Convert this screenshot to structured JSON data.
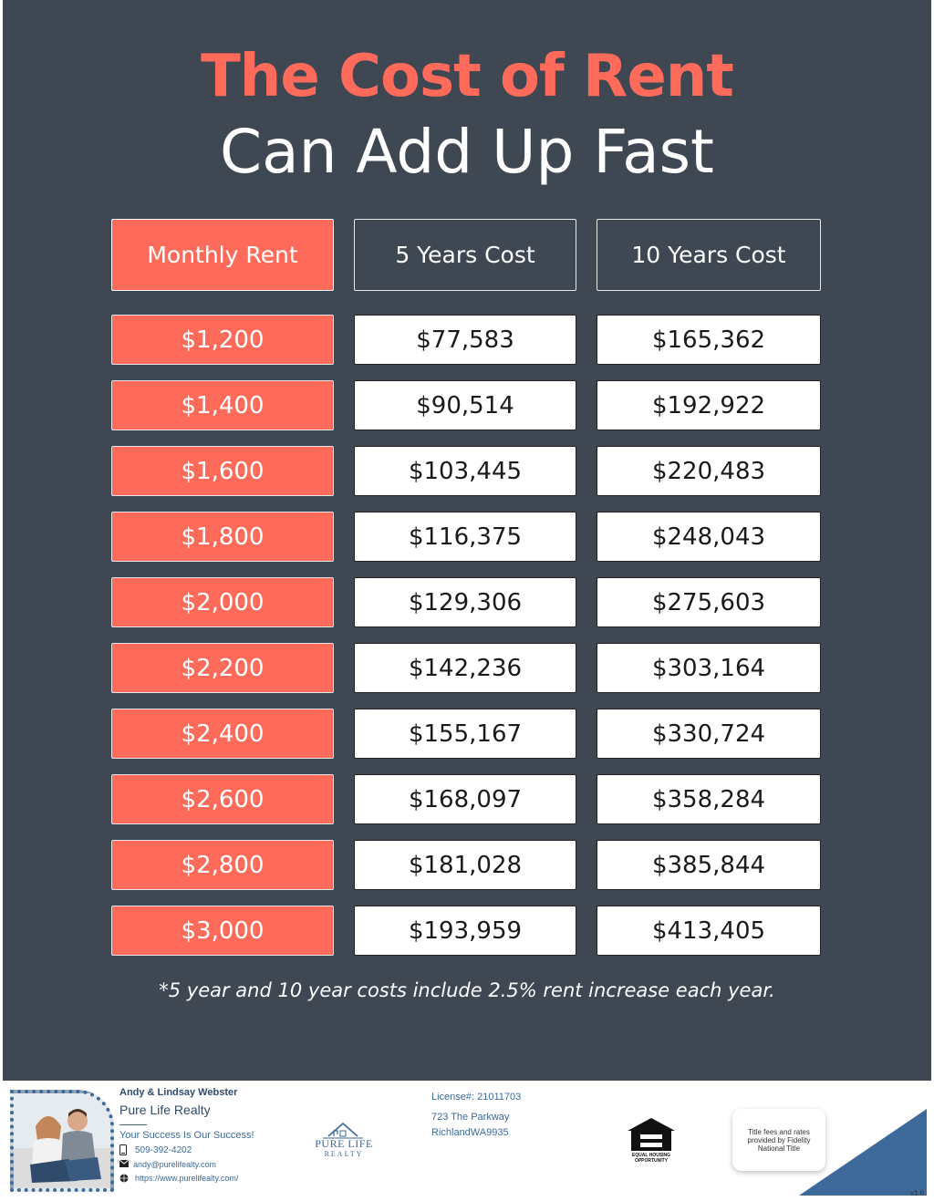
{
  "header": {
    "title_line1": "The Cost of Rent",
    "title_line2": "Can Add Up Fast"
  },
  "table": {
    "columns": [
      "Monthly Rent",
      "5 Years Cost",
      "10 Years Cost"
    ],
    "rows": [
      [
        "$1,200",
        "$77,583",
        "$165,362"
      ],
      [
        "$1,400",
        "$90,514",
        "$192,922"
      ],
      [
        "$1,600",
        "$103,445",
        "$220,483"
      ],
      [
        "$1,800",
        "$116,375",
        "$248,043"
      ],
      [
        "$2,000",
        "$129,306",
        "$275,603"
      ],
      [
        "$2,200",
        "$142,236",
        "$303,164"
      ],
      [
        "$2,400",
        "$155,167",
        "$330,724"
      ],
      [
        "$2,600",
        "$168,097",
        "$358,284"
      ],
      [
        "$2,800",
        "$181,028",
        "$385,844"
      ],
      [
        "$3,000",
        "$193,959",
        "$413,405"
      ]
    ]
  },
  "footnote": "*5 year and 10 year costs include 2.5% rent increase each year.",
  "footer": {
    "agent_name": "Andy & Lindsay Webster",
    "company": "Pure Life Realty",
    "tagline": "Your Success Is Our Success!",
    "phone": "509-392-4202",
    "email": "andy@purelifealty.com",
    "website": "https://www.purelifealty.com/",
    "logo_text_top": "PURE LIFE",
    "logo_text_bottom": "REALTY",
    "license": "License#: 21011703",
    "address_line1": "723 The Parkway",
    "address_line2": "RichlandWA9935",
    "eho_text": "EQUAL HOUSING OPPORTUNITY",
    "title_note": "Title fees and rates provided by Fidelity National Title",
    "version": "v1.6"
  },
  "colors": {
    "background": "#3f4753",
    "accent": "#ff6b5a",
    "brand_blue": "#3d6a9a"
  }
}
